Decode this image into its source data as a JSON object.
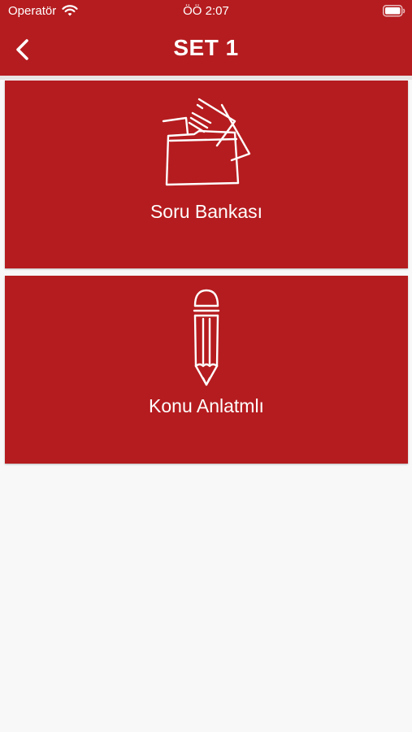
{
  "status_bar": {
    "carrier": "Operatör",
    "time": "ÖÖ 2:07",
    "wifi_icon": "wifi-icon",
    "battery_icon": "battery-icon"
  },
  "header": {
    "title": "SET 1",
    "back_icon": "chevron-left-icon"
  },
  "menu": {
    "items": [
      {
        "label": "Soru Bankası",
        "icon": "folder-papers-icon"
      },
      {
        "label": "Konu Anlatmlı",
        "icon": "pencil-icon"
      }
    ]
  },
  "colors": {
    "primary": "#b51c1f",
    "background": "#f8f8f8",
    "text_on_primary": "#ffffff"
  }
}
